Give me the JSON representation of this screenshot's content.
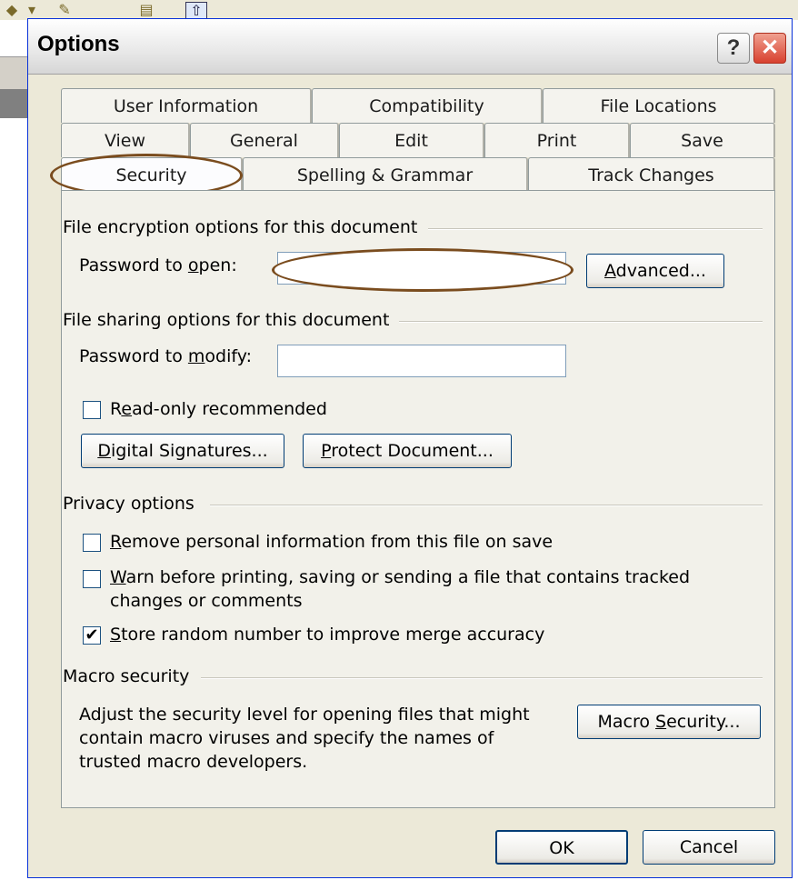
{
  "dialog": {
    "title": "Options",
    "help_glyph": "?",
    "close_glyph": "✕"
  },
  "tabs": {
    "row1": [
      "User Information",
      "Compatibility",
      "File Locations"
    ],
    "row2": [
      "View",
      "General",
      "Edit",
      "Print",
      "Save"
    ],
    "row3": [
      "Security",
      "Spelling & Grammar",
      "Track Changes"
    ],
    "active": "Security"
  },
  "encryption": {
    "group_label": "File encryption options for this document",
    "password_open_label_pre": "Password to ",
    "password_open_label_u": "o",
    "password_open_label_post": "pen:",
    "password_open_value": "",
    "advanced_button_pre": "",
    "advanced_button_u": "A",
    "advanced_button_post": "dvanced..."
  },
  "sharing": {
    "group_label": "File sharing options for this document",
    "password_modify_label_pre": "Password to ",
    "password_modify_label_u": "m",
    "password_modify_label_post": "odify:",
    "password_modify_value": "",
    "readonly_pre": "R",
    "readonly_u": "e",
    "readonly_post": "ad-only recommended",
    "readonly_checked": false,
    "digital_sig_pre": "",
    "digital_sig_u": "D",
    "digital_sig_post": "igital Signatures...",
    "protect_pre": "",
    "protect_u": "P",
    "protect_post": "rotect Document..."
  },
  "privacy": {
    "group_label": "Privacy options",
    "remove_u": "R",
    "remove_post": "emove personal information from this file on save",
    "remove_checked": false,
    "warn_u": "W",
    "warn_post": "arn before printing, saving or sending a file that contains tracked",
    "warn_line2": "changes or comments",
    "warn_checked": false,
    "store_u": "S",
    "store_post": "tore random number to improve merge accuracy",
    "store_checked": true
  },
  "macro": {
    "group_label": "Macro security",
    "line1": "Adjust the security level for opening files that might",
    "line2": "contain macro viruses and specify the names of",
    "line3": "trusted macro developers.",
    "button_pre": "Macro ",
    "button_u": "S",
    "button_post": "ecurity..."
  },
  "footer": {
    "ok": "OK",
    "cancel": "Cancel"
  },
  "colors": {
    "annotation_ring": "#7a4c1e",
    "dialog_bg": "#ece9d8",
    "close_button": "#d8412f"
  }
}
